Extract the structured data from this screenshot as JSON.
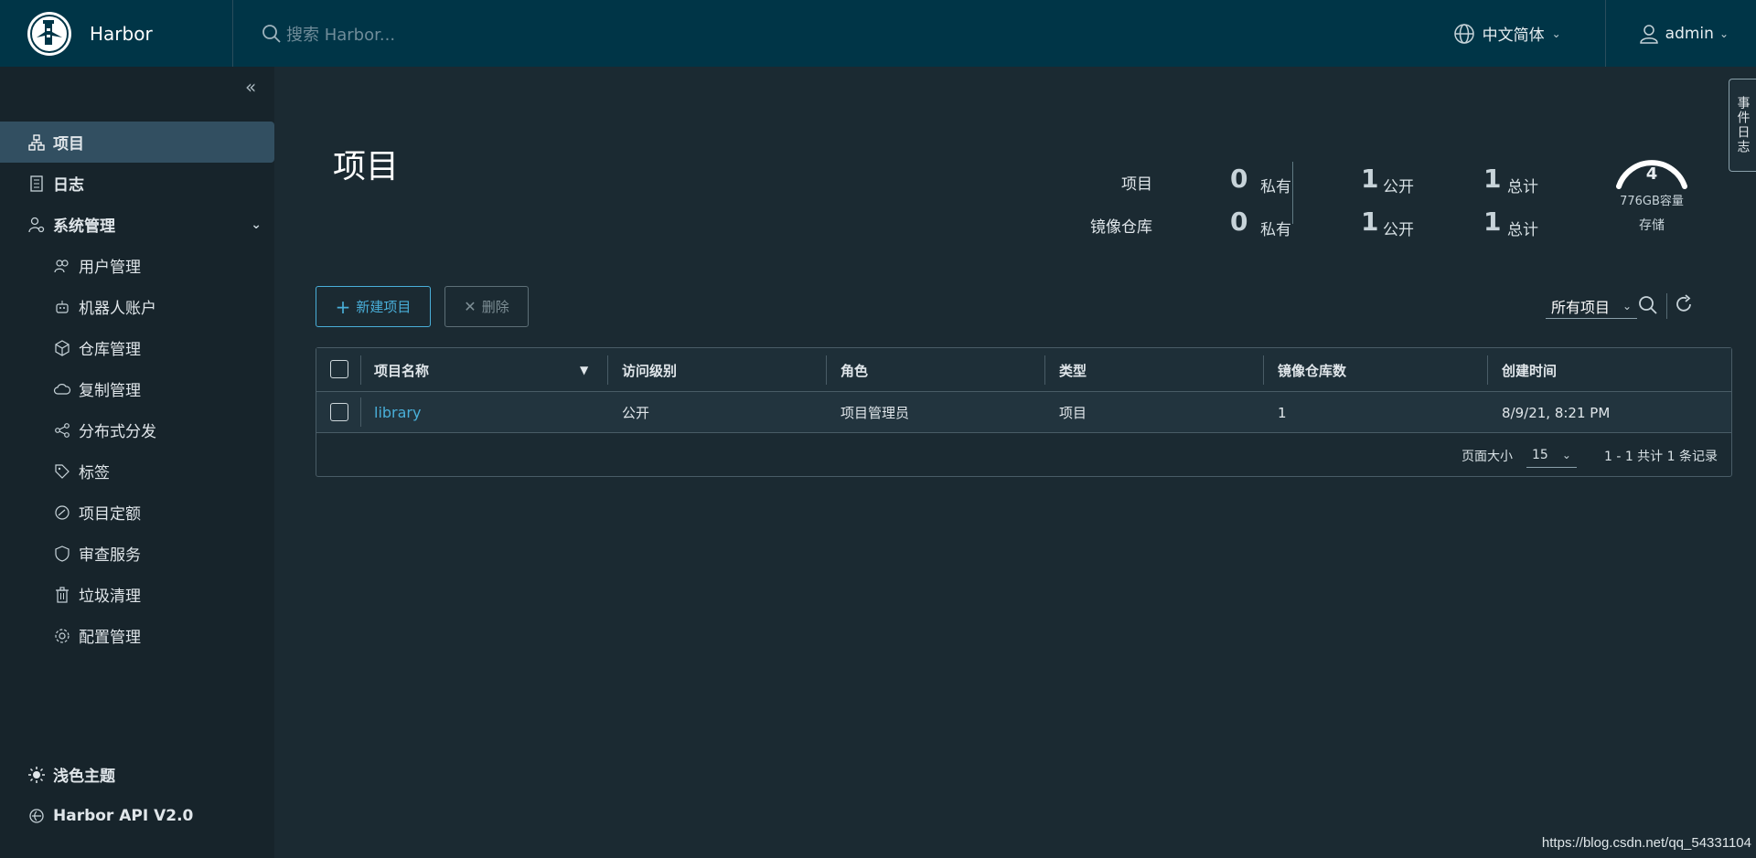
{
  "header": {
    "brand": "Harbor",
    "search_placeholder": "搜索 Harbor...",
    "language": "中文简体",
    "user": "admin"
  },
  "sidebar": {
    "items": [
      {
        "label": "项目",
        "icon": "projects-icon",
        "active": true
      },
      {
        "label": "日志",
        "icon": "logs-icon"
      },
      {
        "label": "系统管理",
        "icon": "admin-icon",
        "expandable": true
      }
    ],
    "sub_items": [
      {
        "label": "用户管理",
        "icon": "users-icon"
      },
      {
        "label": "机器人账户",
        "icon": "robot-icon"
      },
      {
        "label": "仓库管理",
        "icon": "registry-icon"
      },
      {
        "label": "复制管理",
        "icon": "replication-icon"
      },
      {
        "label": "分布式分发",
        "icon": "share-icon"
      },
      {
        "label": "标签",
        "icon": "tag-icon"
      },
      {
        "label": "项目定额",
        "icon": "quota-icon"
      },
      {
        "label": "审查服务",
        "icon": "shield-icon"
      },
      {
        "label": "垃圾清理",
        "icon": "trash-icon"
      },
      {
        "label": "配置管理",
        "icon": "gear-icon"
      }
    ],
    "bottom": [
      {
        "label": "浅色主题",
        "icon": "sun-icon"
      },
      {
        "label": "Harbor API V2.0",
        "icon": "api-icon"
      }
    ]
  },
  "main": {
    "title": "项目",
    "stats": {
      "rows": [
        {
          "label": "项目",
          "private": "0",
          "public": "1",
          "total": "1"
        },
        {
          "label": "镜像仓库",
          "private": "0",
          "public": "1",
          "total": "1"
        }
      ],
      "private_label": "私有",
      "public_label": "公开",
      "total_label": "总计"
    },
    "storage": {
      "value": "4",
      "capacity": "776GB容量",
      "label": "存储"
    },
    "toolbar": {
      "new_label": "新建项目",
      "delete_label": "删除",
      "filter": "所有项目"
    },
    "table": {
      "headers": [
        "项目名称",
        "访问级别",
        "角色",
        "类型",
        "镜像仓库数",
        "创建时间"
      ],
      "rows": [
        {
          "name": "library",
          "access": "公开",
          "role": "项目管理员",
          "type": "项目",
          "repos": "1",
          "created": "8/9/21, 8:21 PM"
        }
      ],
      "page_size_label": "页面大小",
      "page_size": "15",
      "summary": "1 - 1 共计 1 条记录"
    }
  },
  "side_tab": "事件日志",
  "watermark": "https://blog.csdn.net/qq_54331104",
  "colors": {
    "header_bg": "#003547",
    "sidebar_bg": "#17242b",
    "main_bg": "#1b2a32",
    "accent": "#49afd9",
    "active_item": "#324f61"
  }
}
